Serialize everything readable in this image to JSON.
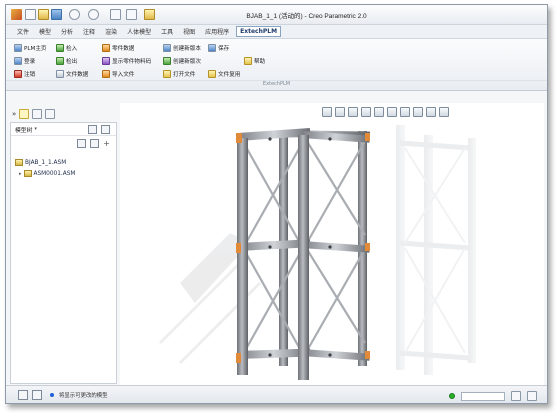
{
  "window": {
    "title": "BJAB_1_1 (活动的) - Creo Parametric 2.0"
  },
  "menu": {
    "items": [
      "文件",
      "模型",
      "分析",
      "注释",
      "渲染",
      "人体模型",
      "工具",
      "视图",
      "应用程序"
    ],
    "active_tab": "ExtechPLM"
  },
  "ribbon": {
    "buttons": [
      {
        "label": "PLM主页",
        "icon": "home-icon"
      },
      {
        "label": "检入",
        "icon": "check-in-icon"
      },
      {
        "label": "零件数据",
        "icon": "part-data-icon"
      },
      {
        "label": "创建新版本",
        "icon": "new-version-icon"
      },
      {
        "label": "保存",
        "icon": "save-icon"
      },
      {
        "label": "登录",
        "icon": "login-icon"
      },
      {
        "label": "检出",
        "icon": "check-out-icon"
      },
      {
        "label": "显示零件物料码",
        "icon": "material-code-icon"
      },
      {
        "label": "创建新版次",
        "icon": "new-revision-icon"
      },
      {
        "label": "帮助",
        "icon": "help-icon"
      },
      {
        "label": "注销",
        "icon": "logout-icon"
      },
      {
        "label": "文件数据",
        "icon": "file-data-icon"
      },
      {
        "label": "导入文件",
        "icon": "import-file-icon"
      },
      {
        "label": "打开文件",
        "icon": "open-file-icon"
      },
      {
        "label": "文件复用",
        "icon": "file-reuse-icon"
      }
    ],
    "group_label": "ExtechPLM"
  },
  "panel": {
    "tab_label": "模型树",
    "tree": [
      {
        "label": "BJAB_1_1.ASM"
      },
      {
        "label": "ASM0001.ASM"
      }
    ]
  },
  "status": {
    "message": "将显示可更改的模型"
  },
  "colors": {
    "accent": "#2f5fa8",
    "frame": "#8e9aa8",
    "truss": "#8a8e93",
    "joint": "#e08a3a",
    "status_ok": "#28b028"
  }
}
